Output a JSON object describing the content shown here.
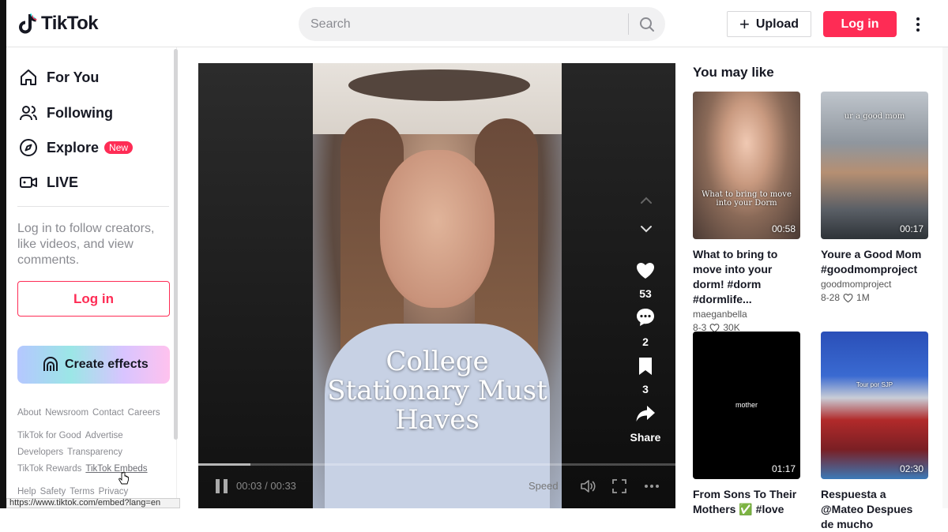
{
  "app": {
    "name": "TikTok"
  },
  "header": {
    "search_placeholder": "Search",
    "upload_label": "Upload",
    "login_label": "Log in"
  },
  "sidebar": {
    "nav": [
      {
        "label": "For You",
        "icon": "home-icon"
      },
      {
        "label": "Following",
        "icon": "users-icon"
      },
      {
        "label": "Explore",
        "icon": "compass-icon",
        "badge": "New"
      },
      {
        "label": "LIVE",
        "icon": "live-icon"
      }
    ],
    "login_prompt": "Log in to follow creators, like videos, and view comments.",
    "login_button": "Log in",
    "create_effects": "Create effects",
    "footer": {
      "row1": [
        "About",
        "Newsroom",
        "Contact",
        "Careers"
      ],
      "row2": [
        "TikTok for Good",
        "Advertise"
      ],
      "row3": [
        "Developers",
        "Transparency"
      ],
      "row4": [
        "TikTok Rewards",
        "TikTok Embeds"
      ],
      "row5": [
        "Help",
        "Safety",
        "Terms",
        "Privacy"
      ]
    },
    "status_url": "https://www.tiktok.com/embed?lang=en"
  },
  "player": {
    "caption": "College Stationary Must Haves",
    "likes": "53",
    "comments": "2",
    "saves": "3",
    "share_label": "Share",
    "current_time": "00:03",
    "duration": "00:33",
    "time_display": "00:03 / 00:33",
    "speed_label": "Speed",
    "progress": 0.11
  },
  "recommendations": {
    "title": "You may like",
    "items": [
      {
        "title": "What to bring to move into your dorm! #dorm #dormlife...",
        "author": "maeganbella",
        "date": "8-3",
        "likes": "30K",
        "duration": "00:58",
        "overlay": "What to bring to move into your Dorm"
      },
      {
        "title": "Youre a Good Mom #goodmomproject",
        "author": "goodmomproject",
        "date": "8-28",
        "likes": "1M",
        "duration": "00:17",
        "overlay": "ur a good mom"
      },
      {
        "title": "From Sons To Their Mothers ✅ #love",
        "duration": "01:17",
        "overlay": "mother"
      },
      {
        "title": "Respuesta a @Mateo Despues de mucho",
        "duration": "02:30",
        "overlay": "Tour por SJP"
      }
    ]
  },
  "colors": {
    "brand": "#fe2c55",
    "text": "#161823",
    "muted": "#8a8b91"
  }
}
